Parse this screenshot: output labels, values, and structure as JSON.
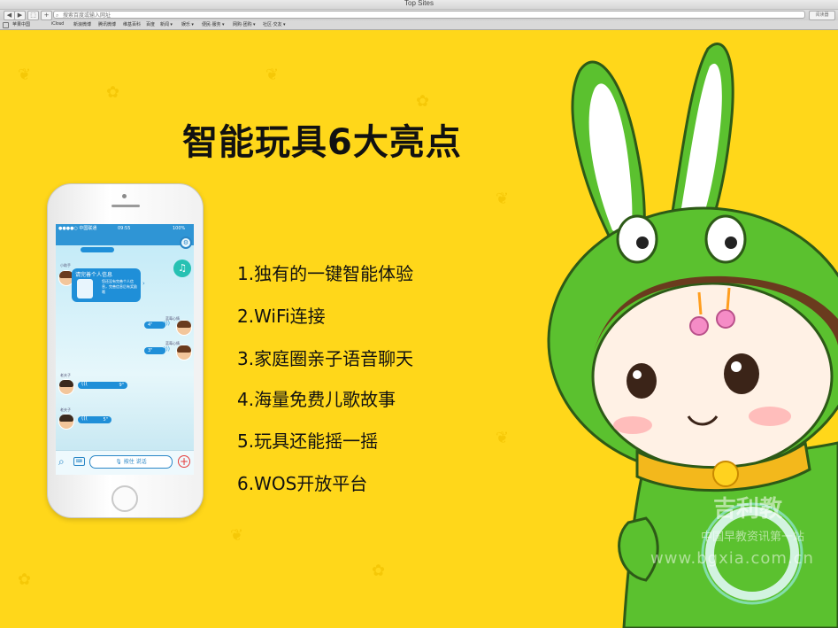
{
  "window": {
    "title": "Top Sites"
  },
  "toolbar": {
    "back": "◀",
    "forward": "▶",
    "share": "⬚",
    "add_tab": "+",
    "url_placeholder": "搜索百度或输入网址",
    "reader": "阅读器"
  },
  "bookmarks": [
    "苹果中国",
    "iCloud",
    "新浪微博",
    "腾讯微博",
    "维基百科",
    "百度",
    "新闻 ▾",
    "娱乐 ▾",
    "便民·服务 ▾",
    "网购·团购 ▾",
    "社区·交友 ▾"
  ],
  "slide": {
    "headline": "智能玩具6大亮点",
    "features": [
      "1.独有的一键智能体验",
      "2.WiFi连接",
      "3.家庭圈亲子语音聊天",
      "4.海量免费儿歌故事",
      "5.玩具还能摇一摇",
      "6.WOS开放平台"
    ]
  },
  "phone": {
    "status": {
      "carrier": "●●●●○ 中国联通",
      "wifi": "WiFi",
      "time": "09:55",
      "battery": "100%"
    },
    "assistant_name": "小助手",
    "card_title": "请完善个人信息",
    "card_text": "您还没有完善个人信息，完善信息后有奖励哦",
    "messages": [
      {
        "sender": "蓝莓心情",
        "duration": "4\""
      },
      {
        "sender": "蓝莓心情",
        "duration": "3\""
      },
      {
        "sender": "老夫子",
        "duration": "9\""
      },
      {
        "sender": "老夫子",
        "duration": "5\""
      }
    ],
    "talk_button": "按住 说话"
  },
  "watermark": {
    "brand": "吉利教",
    "sub": "中国早教资讯第一站",
    "url": "www.bgxia.com.cn"
  },
  "colors": {
    "background": "#ffd71a",
    "app_blue": "#2f95d5",
    "bubble_blue": "#1f8fd8",
    "bunny_green": "#5bc12f"
  }
}
